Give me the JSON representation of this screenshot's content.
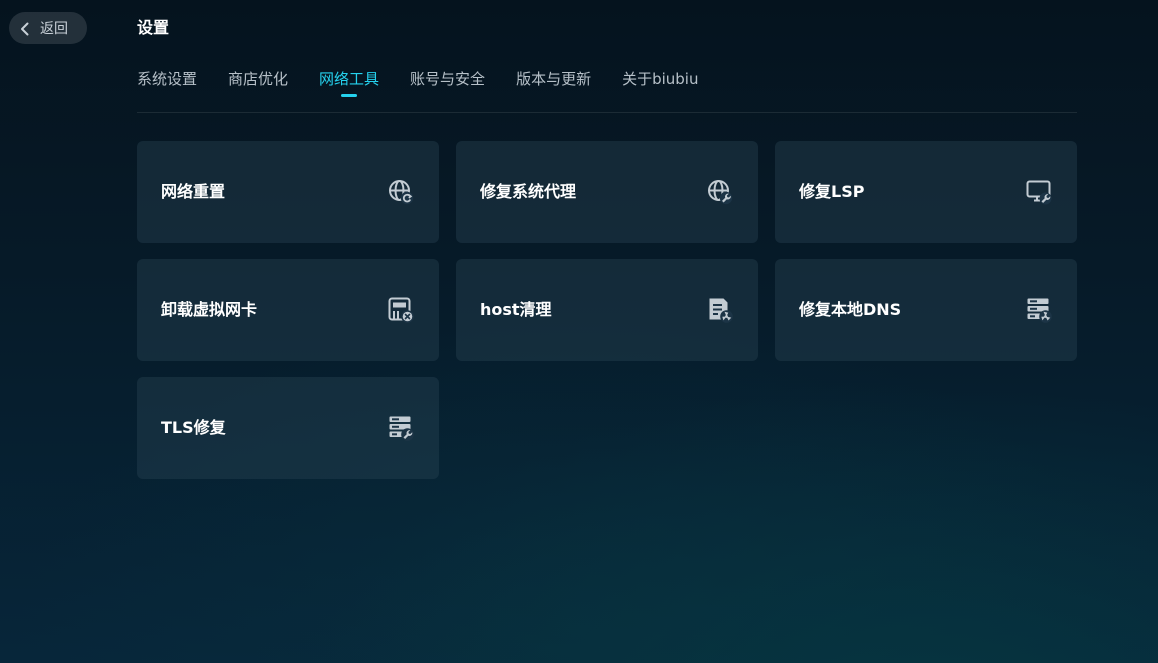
{
  "header": {
    "back_label": "返回",
    "title": "设置"
  },
  "tabs": [
    {
      "label": "系统设置",
      "active": false
    },
    {
      "label": "商店优化",
      "active": false
    },
    {
      "label": "网络工具",
      "active": true
    },
    {
      "label": "账号与安全",
      "active": false
    },
    {
      "label": "版本与更新",
      "active": false
    },
    {
      "label": "关于biubiu",
      "active": false
    }
  ],
  "tools": [
    {
      "label": "网络重置",
      "icon": "globe-refresh-icon"
    },
    {
      "label": "修复系统代理",
      "icon": "globe-wrench-icon"
    },
    {
      "label": "修复LSP",
      "icon": "monitor-wrench-icon"
    },
    {
      "label": "卸载虚拟网卡",
      "icon": "network-card-remove-icon"
    },
    {
      "label": "host清理",
      "icon": "file-clean-icon"
    },
    {
      "label": "修复本地DNS",
      "icon": "server-clean-icon"
    },
    {
      "label": "TLS修复",
      "icon": "server-wrench-icon"
    }
  ],
  "colors": {
    "accent": "#25d2ee",
    "tab_inactive": "#b6c0c8",
    "card_bg": "#1c3446",
    "icon": "#c3ccd3"
  }
}
